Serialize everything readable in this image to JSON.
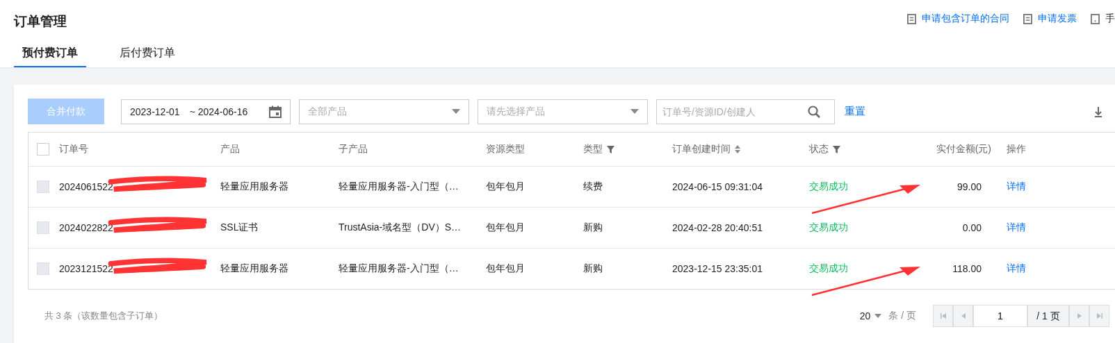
{
  "page": {
    "title": "订单管理"
  },
  "header_links": [
    {
      "label": "申请包含订单的合同",
      "kind": "link"
    },
    {
      "label": "申请发票",
      "kind": "link"
    },
    {
      "label": "手",
      "kind": "plain"
    }
  ],
  "tabs": [
    {
      "label": "预付费订单",
      "selected": true
    },
    {
      "label": "后付费订单",
      "selected": false
    }
  ],
  "toolbar": {
    "merge_button": {
      "label": "合并付款",
      "disabled": true
    },
    "date_start": "2023-12-01",
    "date_end": "~ 2024-06-16",
    "product_select": {
      "placeholder": "全部产品"
    },
    "subproduct_select": {
      "placeholder": "请先选择产品"
    },
    "search": {
      "placeholder": "订单号/资源ID/创建人"
    },
    "reset": "重置"
  },
  "table": {
    "select_all_checked": false,
    "columns": [
      {
        "label": "订单号",
        "kind": "plain"
      },
      {
        "label": "产品",
        "kind": "plain"
      },
      {
        "label": "子产品",
        "kind": "plain"
      },
      {
        "label": "资源类型",
        "kind": "plain"
      },
      {
        "label": "类型",
        "kind": "filter"
      },
      {
        "label": "订单创建时间",
        "kind": "sort"
      },
      {
        "label": "状态",
        "kind": "filter"
      },
      {
        "label": "实付金额(元)",
        "kind": "plain"
      },
      {
        "label": "操作",
        "kind": "plain"
      }
    ],
    "rows": [
      {
        "checked": false,
        "order_id": "2024061522",
        "product": "轻量应用服务器",
        "subproduct": "轻量应用服务器-入门型（…",
        "resource_type": "包年包月",
        "type": "续费",
        "created": "2024-06-15 09:31:04",
        "status": "交易成功",
        "amount": "99.00",
        "action": "详情",
        "arrow": true
      },
      {
        "checked": false,
        "order_id": "2024022822",
        "product": "SSL证书",
        "subproduct": "TrustAsia-域名型（DV）S…",
        "resource_type": "包年包月",
        "type": "新购",
        "created": "2024-02-28 20:40:51",
        "status": "交易成功",
        "amount": "0.00",
        "action": "详情",
        "arrow": false
      },
      {
        "checked": false,
        "order_id": "2023121522",
        "product": "轻量应用服务器",
        "subproduct": "轻量应用服务器-入门型（…",
        "resource_type": "包年包月",
        "type": "新购",
        "created": "2023-12-15 23:35:01",
        "status": "交易成功",
        "amount": "118.00",
        "action": "详情",
        "arrow": true
      }
    ]
  },
  "footer": {
    "total": "共 3 条（该数量包含子订单）",
    "page_size": "20",
    "page_size_unit": "条 / 页",
    "page_input": "1",
    "page_total": "/ 1 页"
  }
}
